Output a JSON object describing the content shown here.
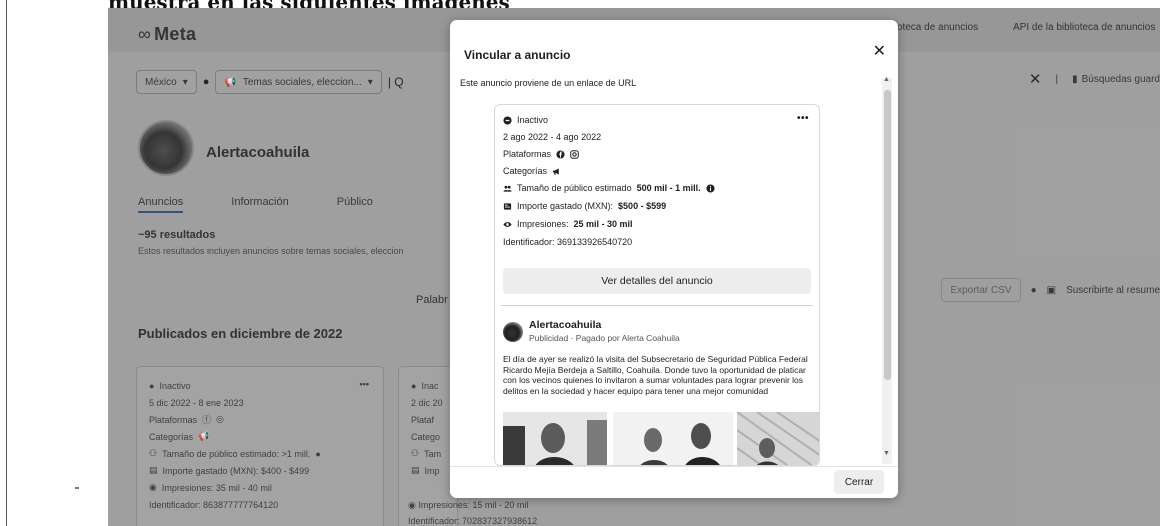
{
  "document": {
    "heading_fragment": "muestra en las siguientes imágenes"
  },
  "background_page": {
    "logo_text": "Meta",
    "top_links": [
      "Biblioteca de anuncios",
      "API de la biblioteca de anuncios"
    ],
    "filters": {
      "country": "México",
      "category": "Temas sociales, eleccion..."
    },
    "saved_searches_label": "Búsquedas guard",
    "page_name": "Alertacoahuila",
    "tabs": [
      "Anuncios",
      "Información",
      "Público"
    ],
    "results_count": "~95 resultados",
    "results_note": "Estos resultados incluyen anuncios sobre temas sociales, eleccion",
    "keyword_label": "Palabr",
    "export_csv_label": "Exportar CSV",
    "subscribe_label": "Suscribirte al resume",
    "section_heading": "Publicados en diciembre de 2022",
    "cards": [
      {
        "status": "Inactivo",
        "dates": "5 dic 2022 - 8 ene 2023",
        "platforms_label": "Plataformas",
        "categories_label": "Categorías",
        "audience": "Tamaño de público estimado: >1 mill.",
        "spend": "Importe gastado (MXN): $400 - $499",
        "impressions": "Impresiones: 35 mil - 40 mil",
        "id": "Identificador: 863877777764120"
      },
      {
        "status": "Inac",
        "dates": "2 dic 20",
        "platforms_label": "Plataf",
        "categories_label": "Catego",
        "audience": "Tam",
        "spend": "Imp",
        "impressions": "Impresiones: 15 mil - 20 mil",
        "id": "Identificador: 702837327938612"
      }
    ]
  },
  "modal": {
    "title": "Vincular a anuncio",
    "subtitle": "Este anuncio proviene de un enlace de URL",
    "close_label": "Cerrar",
    "ad": {
      "status": "Inactivo",
      "dates": "2 ago 2022 - 4 ago 2022",
      "platforms_label": "Plataformas",
      "categories_label": "Categorías",
      "audience_label": "Tamaño de público estimado",
      "audience_value": "500 mil - 1 mill.",
      "spend_label": "Importe gastado (MXN):",
      "spend_value": "$500 - $599",
      "impressions_label": "Impresiones:",
      "impressions_value": "25 mil - 30 mil",
      "identifier": "Identificador: 369133926540720",
      "details_button": "Ver detalles del anuncio",
      "page_name": "Alertacoahuila",
      "paid_by": "Publicidad · Pagado por Alerta Coahuila",
      "body_text": "El día de ayer se realizó la visita del Subsecretario de Seguridad Pública Federal Ricardo Mejía Berdeja a Saltillo, Coahuila. Donde tuvo la oportunidad de platicar con los vecinos quienes lo invitaron a sumar voluntades para lograr prevenir los delitos en la sociedad y hacer equipo para tener una mejor comunidad"
    }
  },
  "colors": {
    "overlay_gray": "#a4a4a4",
    "modal_bg": "#ffffff",
    "button_gray": "#ededed"
  }
}
